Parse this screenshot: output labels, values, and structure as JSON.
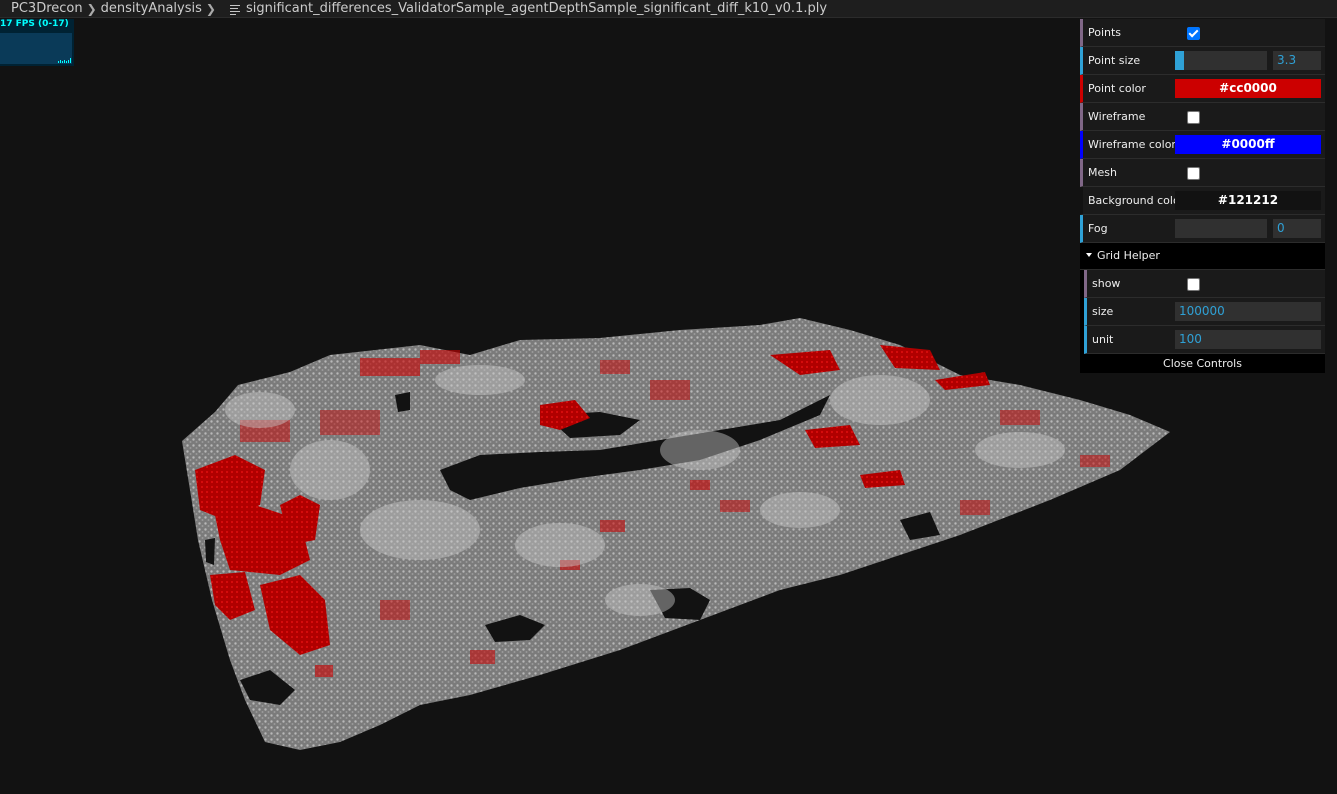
{
  "breadcrumb": {
    "items": [
      "PC3Drecon",
      "densityAnalysis"
    ],
    "file": "significant_differences_ValidatorSample_agentDepthSample_significant_diff_k10_v0.1.ply"
  },
  "stats": {
    "label": "17 FPS (0-17)"
  },
  "controls": {
    "points": {
      "label": "Points",
      "checked": true
    },
    "point_size": {
      "label": "Point size",
      "value": "3.3",
      "fill": 0.09
    },
    "point_color": {
      "label": "Point color",
      "value": "#cc0000"
    },
    "wireframe": {
      "label": "Wireframe",
      "checked": false
    },
    "wireframe_color": {
      "label": "Wireframe color",
      "value": "#0000ff"
    },
    "mesh": {
      "label": "Mesh",
      "checked": false
    },
    "background_color": {
      "label": "Background color",
      "value": "#121212"
    },
    "fog": {
      "label": "Fog",
      "value": "0",
      "fill": 0.0
    },
    "grid_helper": {
      "title": "Grid Helper",
      "show": {
        "label": "show",
        "checked": false
      },
      "size": {
        "label": "size",
        "value": "100000"
      },
      "unit": {
        "label": "unit",
        "value": "100"
      }
    },
    "close_label": "Close Controls"
  },
  "colors": {
    "accent_number": "#2fa1d6",
    "point": "#cc0000",
    "wireframe": "#0000ff",
    "background": "#121212",
    "cloud_gray": "#8a8a8a"
  }
}
